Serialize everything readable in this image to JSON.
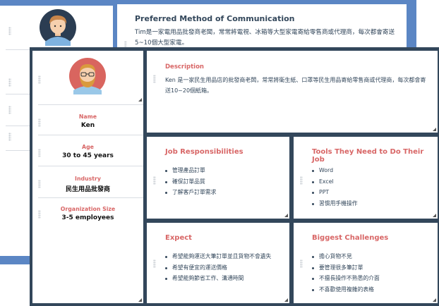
{
  "back_card": {
    "title": "Preferred Method of Communication",
    "text": "Tim是一家電用品批發商老闆，常常將電視、冰箱等大型家電寄給零售商或代理商，每次都會寄送5~10個大型家電。"
  },
  "profile": {
    "fields": [
      {
        "label": "Name",
        "value": "Ken"
      },
      {
        "label": "Age",
        "value": "30 to 45 years"
      },
      {
        "label": "Industry",
        "value": "民生用品批發商"
      },
      {
        "label": "Organization Size",
        "value": "3-5 employees"
      }
    ]
  },
  "description": {
    "title": "Description",
    "text": "Ken 是一家民生用品店的批發商老闆，常常將衛生紙、口罩等民生用品寄給零售商或代理商，每次都會寄送10~20個紙箱。"
  },
  "panels": {
    "job": {
      "title": "Job Responsibilities",
      "items": [
        "管理產品訂單",
        "確保訂單品質",
        "了解客戶訂單需求"
      ]
    },
    "tools": {
      "title": "Tools They Need to Do Their Job",
      "items": [
        "Word",
        "Excel",
        "PPT",
        "習慣用手機操作"
      ]
    },
    "expect": {
      "title": "Expect",
      "items": [
        "希望能夠運送大筆訂單並且貨物不會遺失",
        "希望有便宜的運送價格",
        "希望能夠節省工作、溝通時間"
      ]
    },
    "challenges": {
      "title": "Biggest Challenges",
      "items": [
        "擔心貨物不見",
        "要管理很多筆訂單",
        "不擅長操作不熟悉的介面",
        "不喜歡使用複雜的表格"
      ]
    }
  },
  "colors": {
    "accent": "#d86666",
    "frame": "#33475b",
    "background_blue": "#5b86c4"
  }
}
